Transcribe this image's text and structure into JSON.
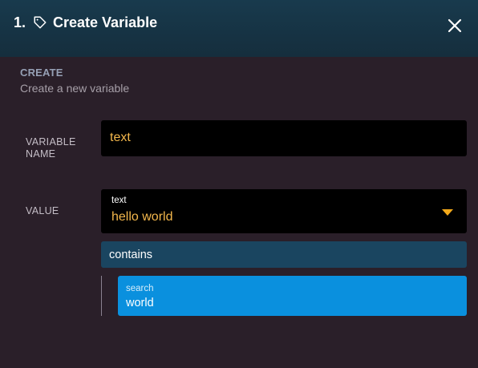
{
  "header": {
    "step": "1.",
    "title": "Create Variable",
    "icon": "tag-icon",
    "close_icon": "close-icon"
  },
  "section": {
    "title": "CREATE",
    "subtitle": "Create a new variable"
  },
  "fields": {
    "variable_name_label_line1": "VARIABLE",
    "variable_name_label_line2": "NAME",
    "variable_name_value": "text",
    "value_label": "VALUE"
  },
  "value_select": {
    "type_label": "text",
    "selected": "hello world"
  },
  "operator": {
    "label": "contains"
  },
  "search": {
    "label": "search",
    "value": "world"
  },
  "colors": {
    "header_bg": "#183a4d",
    "body_bg": "#2a1f29",
    "accent_value": "#f3b74c",
    "caret": "#f3a91a",
    "operator_bg": "#1a4560",
    "search_bg": "#0a90de"
  }
}
